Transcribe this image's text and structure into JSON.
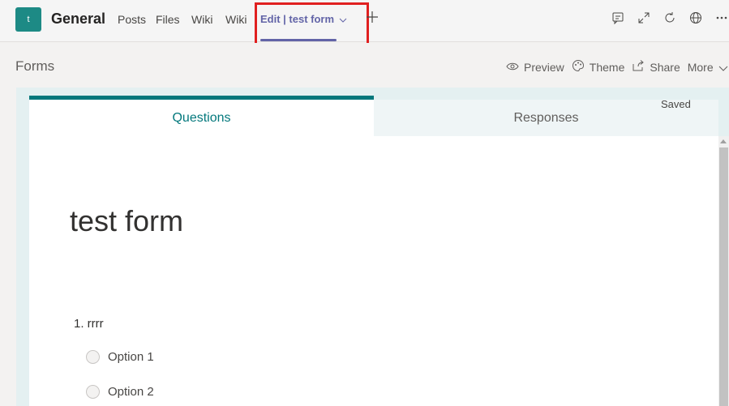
{
  "header": {
    "avatar_letter": "t",
    "channel_title": "General",
    "tabs": [
      {
        "label": "Posts"
      },
      {
        "label": "Files"
      },
      {
        "label": "Wiki"
      },
      {
        "label": "Wiki"
      }
    ],
    "active_tab": {
      "label": "Edit | test form"
    },
    "add_tab_icon": "plus-icon",
    "top_icons": [
      "conversation-icon",
      "expand-icon",
      "refresh-icon",
      "globe-icon",
      "more-icon"
    ]
  },
  "subheader": {
    "title": "Forms",
    "actions": [
      {
        "label": "Preview",
        "icon": "eye-icon"
      },
      {
        "label": "Theme",
        "icon": "palette-icon"
      },
      {
        "label": "Share",
        "icon": "share-icon"
      },
      {
        "label": "More",
        "icon": "chevron-down-icon"
      }
    ]
  },
  "form": {
    "tabs": [
      {
        "label": "Questions"
      },
      {
        "label": "Responses"
      }
    ],
    "status": "Saved",
    "title": "test form",
    "question": "1. rrrr",
    "options": [
      {
        "label": "Option 1"
      },
      {
        "label": "Option 2"
      }
    ]
  },
  "colors": {
    "accent": "#6264a7",
    "forms_teal": "#03787c",
    "highlight": "#e02020",
    "avatar": "#1d8a85"
  }
}
